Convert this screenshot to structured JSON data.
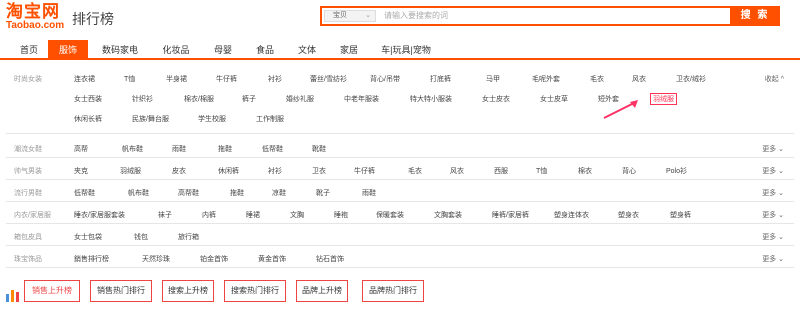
{
  "header": {
    "logo_main": "淘宝网",
    "logo_sub": "Taobao.com",
    "title": "排行榜"
  },
  "search": {
    "select_value": "宝贝",
    "placeholder": "请输入要搜索的词",
    "button": "搜 索"
  },
  "nav": {
    "items": [
      "首页",
      "服饰",
      "数码家电",
      "化妆品",
      "母婴",
      "食品",
      "文体",
      "家居",
      "车|玩具|宠物"
    ]
  },
  "categories": {
    "row1": {
      "label": "时尚女装",
      "line1": [
        "连衣裙",
        "T恤",
        "半身裙",
        "牛仔裤",
        "衬衫",
        "蕾丝/雪纺衫",
        "背心/吊带",
        "打底裤",
        "马甲",
        "毛呢外套",
        "毛衣",
        "风衣",
        "卫衣/绒衫"
      ],
      "line2": [
        "女士西装",
        "针织衫",
        "棉衣/棉服",
        "裤子",
        "婚纱礼服",
        "中老年服装",
        "特大特小服装",
        "女士皮衣",
        "女士皮草",
        "短外套",
        "羽绒服"
      ],
      "line3": [
        "休闲长裤",
        "民族/舞台服",
        "学生校服",
        "工作制服"
      ],
      "more": "收起"
    },
    "row2": {
      "label": "潮流女鞋",
      "items": [
        "高帮",
        "帆布鞋",
        "雨鞋",
        "拖鞋",
        "低帮鞋",
        "靴鞋"
      ],
      "more": "更多"
    },
    "row3": {
      "label": "帅气男装",
      "items": [
        "夹克",
        "羽绒服",
        "皮衣",
        "休闲裤",
        "衬衫",
        "卫衣",
        "牛仔裤",
        "毛衣",
        "风衣",
        "西服",
        "T恤",
        "棉衣",
        "背心",
        "Polo衫"
      ],
      "more": "更多"
    },
    "row4": {
      "label": "流行男鞋",
      "items": [
        "低帮鞋",
        "帆布鞋",
        "高帮鞋",
        "拖鞋",
        "凉鞋",
        "靴子",
        "雨鞋"
      ],
      "more": "更多"
    },
    "row5": {
      "label": "内衣/家居服",
      "items": [
        "睡衣/家居服套装",
        "袜子",
        "内裤",
        "睡裙",
        "文胸",
        "睡袍",
        "保暖套装",
        "文胸套装",
        "睡裤/家居裤",
        "塑身连体衣",
        "塑身衣",
        "塑身裤"
      ],
      "more": "更多"
    },
    "row6": {
      "label": "箱包皮具",
      "items": [
        "女士包袋",
        "钱包",
        "旅行箱"
      ],
      "more": "更多"
    },
    "row7": {
      "label": "珠宝饰品",
      "items": [
        "銷售排行榜",
        "天然珍珠",
        "铂金首饰",
        "黄金首饰",
        "钻石首饰"
      ],
      "more": "更多"
    }
  },
  "bottom_tabs": [
    "销售上升榜",
    "销售热门排行",
    "搜索上升榜",
    "搜索热门排行",
    "品牌上升榜",
    "品牌热门排行"
  ],
  "colors": {
    "accent": "#ff5000",
    "highlight": "#ff3355"
  }
}
